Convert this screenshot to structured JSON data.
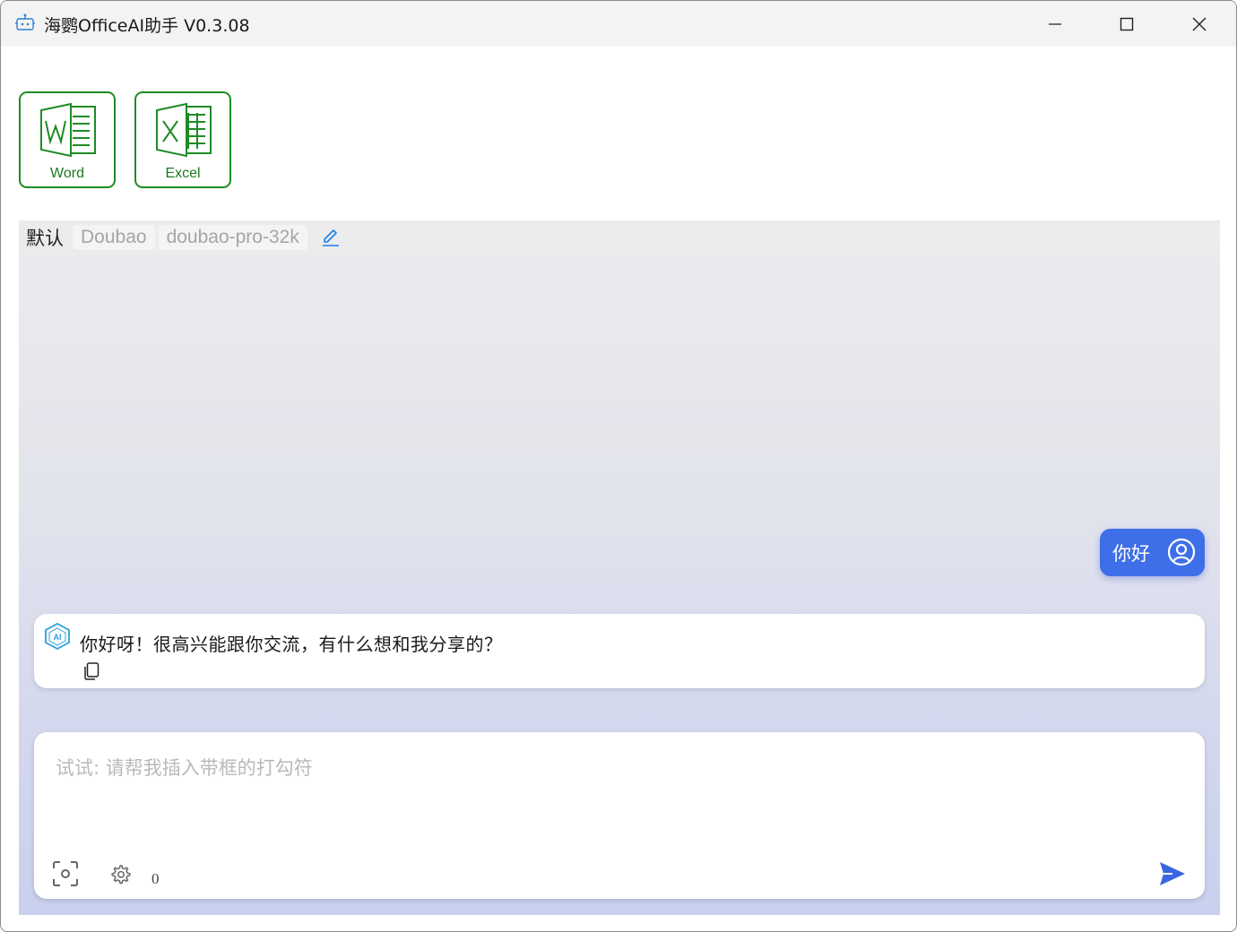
{
  "window": {
    "title": "海鹦OfficeAI助手 V0.3.08",
    "icons": {
      "app": "robot-icon",
      "minimize": "minimize-icon",
      "maximize": "maximize-icon",
      "close": "close-icon"
    }
  },
  "apps": [
    {
      "label": "Word",
      "icon": "word-icon"
    },
    {
      "label": "Excel",
      "icon": "excel-icon"
    }
  ],
  "model_bar": {
    "profile": "默认",
    "provider": "Doubao",
    "model": "doubao-pro-32k",
    "edit_icon": "edit-pencil-icon"
  },
  "conversation": {
    "user_message": "你好",
    "user_avatar_icon": "user-avatar-icon",
    "ai_message": "你好呀！很高兴能跟你交流，有什么想和我分享的？",
    "ai_icon": "ai-logo-icon",
    "copy_icon": "copy-icon"
  },
  "input": {
    "placeholder": "试试: 请帮我插入带框的打勾符",
    "value": "",
    "count": "0",
    "icons": {
      "capture": "screenshot-icon",
      "settings": "gear-icon",
      "send": "send-icon"
    }
  },
  "colors": {
    "accent_green": "#1f8b24",
    "accent_blue": "#3f6fe8",
    "link_blue": "#1e7ee6"
  }
}
